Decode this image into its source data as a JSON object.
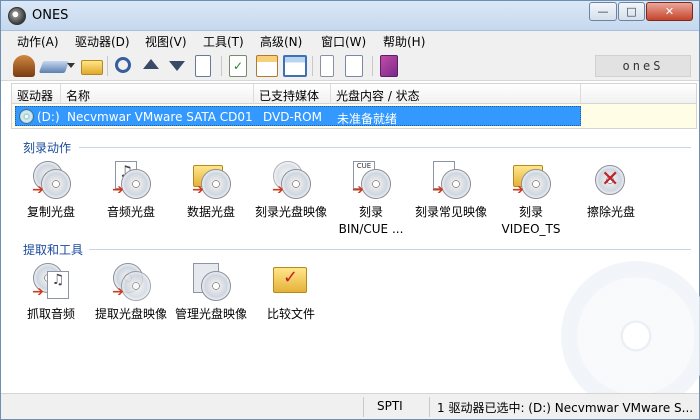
{
  "window": {
    "title": "ONES"
  },
  "window_controls": {
    "minimize": "—",
    "maximize": "□",
    "close": "✕"
  },
  "menu": [
    {
      "label": "动作(A)"
    },
    {
      "label": "驱动器(D)"
    },
    {
      "label": "视图(V)"
    },
    {
      "label": "工具(T)"
    },
    {
      "label": "高级(N)"
    },
    {
      "label": "窗口(W)"
    },
    {
      "label": "帮助(H)"
    }
  ],
  "toolbar": {
    "brand_text": "oneS",
    "buttons": [
      {
        "icon": "wizard-icon"
      },
      {
        "icon": "drive-dropdown-icon"
      },
      {
        "icon": "open-folder-icon"
      },
      {
        "icon": "properties-icon"
      },
      {
        "icon": "eject-icon"
      },
      {
        "icon": "load-tray-icon"
      },
      {
        "icon": "log-icon"
      },
      {
        "icon": "verify-icon"
      },
      {
        "icon": "view-large-icon"
      },
      {
        "icon": "view-details-icon"
      },
      {
        "icon": "notes-icon"
      },
      {
        "icon": "edit-icon"
      },
      {
        "icon": "help-book-icon"
      }
    ]
  },
  "drive_list": {
    "columns": [
      "驱动器",
      "名称",
      "已支持媒体",
      "光盘内容 / 状态"
    ],
    "rows": [
      {
        "drive": "(D:)",
        "name": "Necvmwar VMware SATA CD01",
        "media": "DVD-ROM",
        "status": "未准备就绪"
      }
    ]
  },
  "sections": {
    "burn": {
      "title": "刻录动作",
      "items": [
        {
          "label": "复制光盘",
          "icon": "copy-disc-icon"
        },
        {
          "label": "音频光盘",
          "icon": "audio-disc-icon"
        },
        {
          "label": "数据光盘",
          "icon": "data-disc-icon"
        },
        {
          "label": "刻录光盘映像",
          "icon": "burn-image-icon"
        },
        {
          "label": "刻录",
          "label2": "BIN/CUE ...",
          "icon": "burn-bin-cue-icon"
        },
        {
          "label": "刻录常见映像",
          "icon": "burn-common-image-icon"
        },
        {
          "label": "刻录",
          "label2": "VIDEO_TS",
          "icon": "burn-video-ts-icon"
        },
        {
          "label": "擦除光盘",
          "icon": "erase-disc-icon"
        }
      ]
    },
    "extract": {
      "title": "提取和工具",
      "items": [
        {
          "label": "抓取音频",
          "icon": "rip-audio-icon"
        },
        {
          "label": "提取光盘映像",
          "icon": "extract-image-icon"
        },
        {
          "label": "管理光盘映像",
          "icon": "manage-images-icon"
        },
        {
          "label": "比较文件",
          "icon": "compare-files-icon"
        }
      ]
    }
  },
  "status_bar": {
    "interface": "SPTI",
    "selection": "1 驱动器已选中: (D:) Necvmwar VMware S..."
  }
}
